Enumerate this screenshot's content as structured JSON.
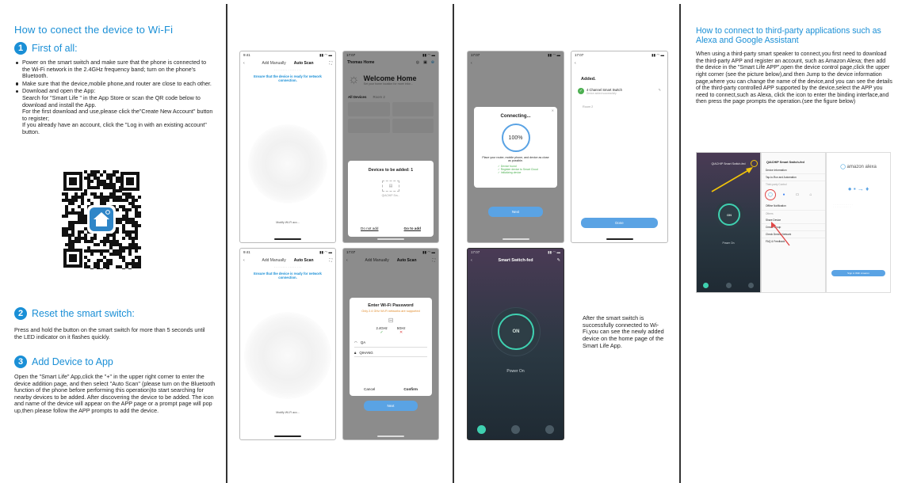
{
  "section1": {
    "title": "How to conect the device to Wi-Fi",
    "step1": {
      "num": "1",
      "label": "First of all:"
    },
    "bullets": [
      "Power on the smart switch and make sure that the phone is connected to the Wi-Fi network in the 2.4GHz frequency band; turn on the phone's Bluetooth.",
      "Make sure that the device,mobile phone,and router are close to each other.",
      "Download and open the App:"
    ],
    "download_lines": [
      "Search for \"Smart Life \" in the App Store or scan the QR code below to download and install the App.",
      "For the first download and use,please click the\"Create New Account\" button to register;",
      "If you already have an account, click the \"Log in with an existing account\" button."
    ],
    "step2": {
      "num": "2",
      "label": "Reset the smart switch:"
    },
    "step2_text": "Press and hold the button on the smart switch for more than 5 seconds until the LED indicator on it flashes quickly.",
    "step3": {
      "num": "3",
      "label": "Add Device to App"
    },
    "step3_text": "Open the \"Smart Life\" App,click the \"+\" in the upper right corner to enter the device addition page, and then select \"Auto Scan\" (please turn on the Bluetooth function of the phone  before performing this operation)to start searching for nearby devices to be added. After discovering the device to be added. The icon and name of the device will appear on the APP page or a prompt page will pop up,then please follow the APP prompts to add the device."
  },
  "phones": {
    "add_manually": "Add Manually",
    "auto_scan": "Auto Scan",
    "ready_text": "Ensure that the device is ready for network connection.",
    "modify_wifi": "Modify Wi-Fi acc...",
    "home_title": "Thomas Home",
    "welcome": "Welcome Home",
    "welcome_sub": "Set your home location for more infor...",
    "all_devices": "All Devices",
    "room": "Room 2",
    "devices_to_add": "Devices to be added: 1",
    "device_name": "QIACHIP Sm...",
    "do_not_add": "Do not add",
    "go_to_add": "Go to add",
    "enter_wifi": "Enter Wi-Fi Password",
    "only_24": "Only 2.4 GHz Wi-Fi networks are supported",
    "band_24": "2.4GHz",
    "band_5": "5GHz",
    "wifi_name": "QA",
    "wifi_pass": "QIHANG",
    "cancel": "Cancel",
    "confirm": "Confirm",
    "next": "Next",
    "connecting": "Connecting...",
    "percent": "100%",
    "place_router": "Place your router, mobile phone, and device as close as possible.",
    "check1": "Device found",
    "check2": "Register device to Smart Cloud",
    "check3": "Initializing device",
    "added": "Added.",
    "channel_switch": "4 Channel Smart Switch",
    "added_success": "Device added successfully",
    "room2": "Room 2",
    "done": "Done",
    "switch_title": "Smart Switch-fed",
    "on": "ON",
    "power_on": "Power On",
    "time_9": "9:41",
    "time_17": "17:07"
  },
  "success_text": "After the smart switch is successfully connected to Wi-Fi,you can see the newly added device on the home page of the Smart Life App.",
  "section4": {
    "title": "How to connect to third-party applications such as Alexa and Google Assistant",
    "body": "When using a third-party smart speaker to connect,you first need to download the third-party APP and register an account, such as Amazon Alexa; then add the device in the \"Smart Life APP\",open the device control page,click the upper right corner (see the picture below),and then Jump to the device information page,where you can change the name of the device,and you can see the details of the third-party controlled APP supported by the device,select the APP you need to connect,such as Alexa, click the icon to enter the binding interface,and then press the page prompts the operation.(see the figure below)",
    "amazon_alexa": "amazon alexa",
    "qiachip": "QIACHIP Smart Switch-fed",
    "device_info": "Device Information",
    "tap_to_run": "Tap-to-Run and Automation",
    "third_party": "Third-party Control",
    "alexa": "Alexa",
    "google": "Google Assistant",
    "offline": "Offline Notification",
    "others": "Others",
    "share_device": "Share Device",
    "create_group": "Create Group",
    "check_network": "Check Device Network",
    "faq": "FAQ & Feedback",
    "sign_in": "Sign in With Amazon",
    "colors": {
      "accent": "#1a8fd6",
      "on_ring": "#3fd0b0",
      "annotation": "#e04848",
      "arrow": "#f2c40a"
    }
  }
}
